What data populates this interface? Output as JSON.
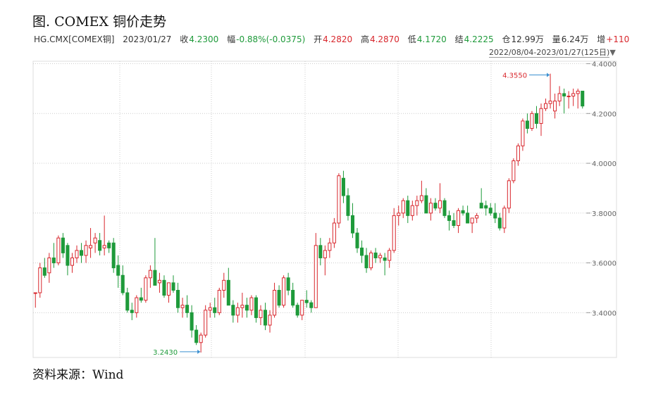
{
  "title": "图. COMEX 铜价走势",
  "info": {
    "symbol": "HG.CMX[COMEX铜]",
    "date": "2023/01/27",
    "close_label": "收",
    "close_value": "4.2300",
    "change_label": "幅",
    "change_value": "-0.88%(-0.0375)",
    "open_label": "开",
    "open_value": "4.2820",
    "high_label": "高",
    "high_value": "4.2870",
    "low_label": "低",
    "low_value": "4.1720",
    "settle_label": "结",
    "settle_value": "4.2225",
    "oi_label": "仓",
    "oi_value": "12.99万",
    "volume_label": "量",
    "volume_value": "6.24万",
    "increase_label": "增",
    "increase_value": "+110"
  },
  "range_text": "2022/08/04-2023/01/27(125日)",
  "source": "资料来源：Wind",
  "colors": {
    "up": "#d8262c",
    "down": "#1e9a3a",
    "grid": "#cccccc",
    "axis_text": "#666666"
  },
  "chart_data": {
    "type": "candlestick",
    "ylim": [
      3.22,
      4.41
    ],
    "yticks": [
      "3.4000",
      "3.6000",
      "3.8000",
      "4.0000",
      "4.2000",
      "4.4000"
    ],
    "annotations": [
      {
        "label": "4.3550",
        "value": 4.355,
        "kind": "max"
      },
      {
        "label": "3.2430",
        "value": 3.243,
        "kind": "min"
      }
    ],
    "candles": [
      [
        3.48,
        3.48,
        3.42,
        3.48
      ],
      [
        3.48,
        3.6,
        3.46,
        3.58
      ],
      [
        3.58,
        3.62,
        3.54,
        3.55
      ],
      [
        3.56,
        3.64,
        3.52,
        3.62
      ],
      [
        3.62,
        3.68,
        3.58,
        3.6
      ],
      [
        3.6,
        3.71,
        3.59,
        3.7
      ],
      [
        3.7,
        3.72,
        3.62,
        3.64
      ],
      [
        3.67,
        3.68,
        3.55,
        3.59
      ],
      [
        3.59,
        3.64,
        3.56,
        3.62
      ],
      [
        3.62,
        3.67,
        3.6,
        3.65
      ],
      [
        3.65,
        3.68,
        3.6,
        3.63
      ],
      [
        3.63,
        3.69,
        3.6,
        3.67
      ],
      [
        3.66,
        3.74,
        3.62,
        3.67
      ],
      [
        3.68,
        3.72,
        3.64,
        3.7
      ],
      [
        3.69,
        3.72,
        3.63,
        3.65
      ],
      [
        3.66,
        3.79,
        3.63,
        3.67
      ],
      [
        3.68,
        3.69,
        3.64,
        3.66
      ],
      [
        3.68,
        3.7,
        3.56,
        3.58
      ],
      [
        3.59,
        3.63,
        3.5,
        3.55
      ],
      [
        3.55,
        3.59,
        3.47,
        3.48
      ],
      [
        3.48,
        3.5,
        3.4,
        3.41
      ],
      [
        3.41,
        3.44,
        3.37,
        3.4
      ],
      [
        3.4,
        3.47,
        3.38,
        3.46
      ],
      [
        3.46,
        3.5,
        3.44,
        3.45
      ],
      [
        3.45,
        3.55,
        3.44,
        3.54
      ],
      [
        3.54,
        3.59,
        3.5,
        3.57
      ],
      [
        3.57,
        3.7,
        3.55,
        3.51
      ],
      [
        3.52,
        3.56,
        3.48,
        3.53
      ],
      [
        3.53,
        3.55,
        3.46,
        3.47
      ],
      [
        3.47,
        3.52,
        3.44,
        3.52
      ],
      [
        3.52,
        3.55,
        3.48,
        3.49
      ],
      [
        3.49,
        3.52,
        3.4,
        3.42
      ],
      [
        3.42,
        3.46,
        3.38,
        3.43
      ],
      [
        3.43,
        3.47,
        3.38,
        3.4
      ],
      [
        3.4,
        3.43,
        3.3,
        3.33
      ],
      [
        3.33,
        3.35,
        3.27,
        3.28
      ],
      [
        3.28,
        3.32,
        3.24,
        3.31
      ],
      [
        3.31,
        3.43,
        3.3,
        3.41
      ],
      [
        3.41,
        3.44,
        3.38,
        3.42
      ],
      [
        3.42,
        3.46,
        3.38,
        3.4
      ],
      [
        3.4,
        3.5,
        3.39,
        3.49
      ],
      [
        3.49,
        3.56,
        3.46,
        3.53
      ],
      [
        3.53,
        3.58,
        3.5,
        3.43
      ],
      [
        3.43,
        3.45,
        3.36,
        3.39
      ],
      [
        3.39,
        3.44,
        3.36,
        3.42
      ],
      [
        3.42,
        3.48,
        3.38,
        3.43
      ],
      [
        3.43,
        3.46,
        3.38,
        3.41
      ],
      [
        3.41,
        3.47,
        3.39,
        3.46
      ],
      [
        3.46,
        3.47,
        3.36,
        3.38
      ],
      [
        3.38,
        3.43,
        3.35,
        3.41
      ],
      [
        3.41,
        3.44,
        3.33,
        3.35
      ],
      [
        3.35,
        3.41,
        3.32,
        3.39
      ],
      [
        3.39,
        3.52,
        3.38,
        3.49
      ],
      [
        3.49,
        3.51,
        3.42,
        3.43
      ],
      [
        3.43,
        3.55,
        3.42,
        3.54
      ],
      [
        3.54,
        3.56,
        3.47,
        3.49
      ],
      [
        3.49,
        3.52,
        3.42,
        3.43
      ],
      [
        3.43,
        3.44,
        3.38,
        3.39
      ],
      [
        3.39,
        3.45,
        3.37,
        3.45
      ],
      [
        3.45,
        3.49,
        3.42,
        3.44
      ],
      [
        3.44,
        3.45,
        3.4,
        3.42
      ],
      [
        3.42,
        3.72,
        3.42,
        3.67
      ],
      [
        3.67,
        3.7,
        3.59,
        3.62
      ],
      [
        3.62,
        3.67,
        3.55,
        3.65
      ],
      [
        3.65,
        3.7,
        3.62,
        3.68
      ],
      [
        3.68,
        3.78,
        3.66,
        3.76
      ],
      [
        3.76,
        3.96,
        3.74,
        3.95
      ],
      [
        3.94,
        3.97,
        3.84,
        3.87
      ],
      [
        3.87,
        3.9,
        3.77,
        3.79
      ],
      [
        3.79,
        3.84,
        3.7,
        3.72
      ],
      [
        3.72,
        3.74,
        3.64,
        3.66
      ],
      [
        3.66,
        3.69,
        3.6,
        3.63
      ],
      [
        3.63,
        3.66,
        3.56,
        3.58
      ],
      [
        3.58,
        3.65,
        3.57,
        3.64
      ],
      [
        3.64,
        3.66,
        3.6,
        3.62
      ],
      [
        3.62,
        3.64,
        3.6,
        3.63
      ],
      [
        3.62,
        3.64,
        3.55,
        3.61
      ],
      [
        3.61,
        3.66,
        3.58,
        3.65
      ],
      [
        3.65,
        3.82,
        3.64,
        3.79
      ],
      [
        3.79,
        3.83,
        3.75,
        3.8
      ],
      [
        3.8,
        3.86,
        3.78,
        3.85
      ],
      [
        3.85,
        3.87,
        3.76,
        3.79
      ],
      [
        3.79,
        3.85,
        3.77,
        3.83
      ],
      [
        3.83,
        3.87,
        3.79,
        3.85
      ],
      [
        3.85,
        3.93,
        3.84,
        3.87
      ],
      [
        3.87,
        3.9,
        3.8,
        3.8
      ],
      [
        3.8,
        3.86,
        3.77,
        3.84
      ],
      [
        3.84,
        3.86,
        3.81,
        3.82
      ],
      [
        3.82,
        3.92,
        3.8,
        3.85
      ],
      [
        3.85,
        3.86,
        3.78,
        3.79
      ],
      [
        3.79,
        3.81,
        3.73,
        3.77
      ],
      [
        3.77,
        3.8,
        3.74,
        3.75
      ],
      [
        3.75,
        3.82,
        3.72,
        3.81
      ],
      [
        3.81,
        3.83,
        3.79,
        3.8
      ],
      [
        3.8,
        3.83,
        3.76,
        3.76
      ],
      [
        3.76,
        3.78,
        3.72,
        3.78
      ],
      [
        3.78,
        3.8,
        3.76,
        3.79
      ],
      [
        3.84,
        3.9,
        3.82,
        3.82
      ],
      [
        3.83,
        3.85,
        3.79,
        3.82
      ],
      [
        3.82,
        3.84,
        3.79,
        3.8
      ],
      [
        3.8,
        3.84,
        3.76,
        3.78
      ],
      [
        3.78,
        3.8,
        3.73,
        3.74
      ],
      [
        3.74,
        3.83,
        3.72,
        3.82
      ],
      [
        3.82,
        3.94,
        3.8,
        3.93
      ],
      [
        3.93,
        4.02,
        3.92,
        4.01
      ],
      [
        4.01,
        4.08,
        3.99,
        4.07
      ],
      [
        4.07,
        4.18,
        4.05,
        4.17
      ],
      [
        4.17,
        4.2,
        4.12,
        4.14
      ],
      [
        4.14,
        4.21,
        4.13,
        4.2
      ],
      [
        4.2,
        4.23,
        4.14,
        4.16
      ],
      [
        4.16,
        4.24,
        4.11,
        4.22
      ],
      [
        4.22,
        4.26,
        4.21,
        4.24
      ],
      [
        4.24,
        4.36,
        4.22,
        4.25
      ],
      [
        4.21,
        4.28,
        4.18,
        4.25
      ],
      [
        4.25,
        4.31,
        4.23,
        4.28
      ],
      [
        4.28,
        4.3,
        4.2,
        4.27
      ],
      [
        4.27,
        4.29,
        4.22,
        4.27
      ],
      [
        4.27,
        4.3,
        4.23,
        4.28
      ],
      [
        4.28,
        4.3,
        4.22,
        4.29
      ],
      [
        4.29,
        4.29,
        4.22,
        4.23
      ]
    ]
  }
}
